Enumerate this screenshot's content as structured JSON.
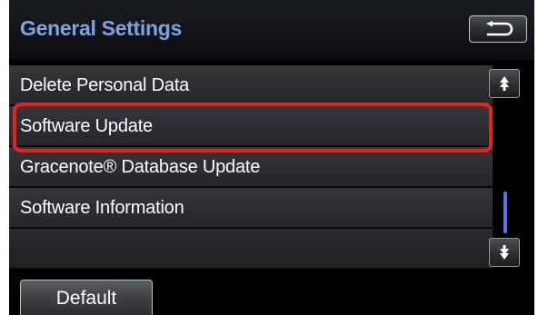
{
  "header": {
    "title": "General Settings",
    "back_icon": "return-arrow-icon"
  },
  "list": {
    "items": [
      {
        "label": "Delete Personal Data"
      },
      {
        "label": "Software Update"
      },
      {
        "label": "Gracenote® Database Update"
      },
      {
        "label": "Software Information"
      },
      {
        "label": ""
      }
    ],
    "highlighted_item": "Software Update"
  },
  "scroll": {
    "up_icon": "scroll-up-icon",
    "down_icon": "scroll-down-icon"
  },
  "footer": {
    "default_label": "Default"
  },
  "colors": {
    "title": "#7ea2e6",
    "highlight": "#e5221b",
    "scroll_thumb": "#4f78e8"
  }
}
